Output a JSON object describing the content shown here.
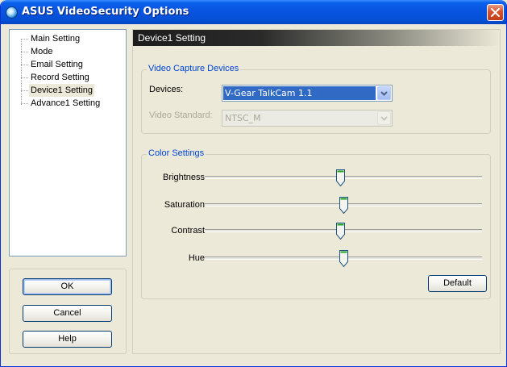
{
  "window": {
    "title": "ASUS VideoSecurity Options"
  },
  "nav": {
    "items": [
      {
        "label": "Main Setting"
      },
      {
        "label": "Mode"
      },
      {
        "label": "Email Setting"
      },
      {
        "label": "Record Setting"
      },
      {
        "label": "Device1 Setting",
        "selected": true
      },
      {
        "label": "Advance1 Setting"
      }
    ]
  },
  "buttons": {
    "ok": "OK",
    "cancel": "Cancel",
    "help": "Help",
    "default": "Default"
  },
  "page": {
    "header": "Device1 Setting",
    "capture_group": {
      "title": "Video Capture Devices",
      "devices_label": "Devices:",
      "devices_value": "V-Gear TalkCam 1.1",
      "standard_label": "Video Standard:",
      "standard_value": "NTSC_M"
    },
    "color_group": {
      "title": "Color Settings",
      "sliders": [
        {
          "label": "Brightness",
          "value": 0.49
        },
        {
          "label": "Saturation",
          "value": 0.5
        },
        {
          "label": "Contrast",
          "value": 0.49
        },
        {
          "label": "Hue",
          "value": 0.5
        }
      ]
    }
  },
  "colors": {
    "titlebar": "#0854e0",
    "group_label": "#0046d5",
    "selection": "#316ac5"
  }
}
